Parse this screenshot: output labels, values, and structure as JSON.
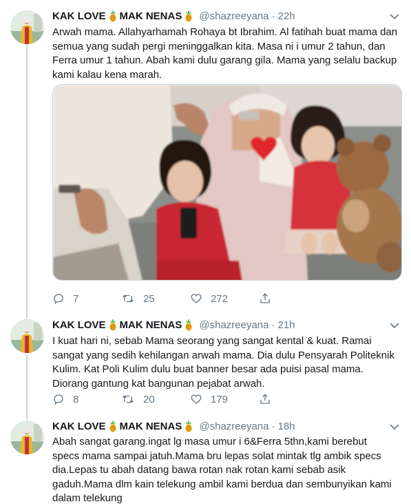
{
  "tweets": [
    {
      "display_name_1": "KAK LOVE",
      "display_name_2": "MAK NENAS",
      "handle": "@shazreeyana",
      "separator": "·",
      "time": "22h",
      "lines": [
        "Arwah mama. Allahyarhamah Rohaya bt Ibrahim. Al fatihah buat mama dan",
        "semua yang sudah pergi meninggalkan kita. Masa ni i umur 2 tahun, dan",
        "Ferra umur 1 tahun. Abah kami dulu garang gila. Mama yang selalu backup",
        "kami kalau kena marah."
      ],
      "replies": "7",
      "retweets": "25",
      "likes": "272"
    },
    {
      "display_name_1": "KAK LOVE",
      "display_name_2": "MAK NENAS",
      "handle": "@shazreeyana",
      "separator": "·",
      "time": "21h",
      "lines": [
        "I kuat hari ni, sebab Mama seorang yang sangat kental & kuat. Ramai",
        "sangat yang sedih kehilangan arwah mama. Dia dulu Pensyarah Politeknik",
        "Kulim. Kat Poli Kulim dulu buat banner besar ada puisi pasal mama.",
        "Diorang gantung kat bangunan pejabat arwah."
      ],
      "replies": "8",
      "retweets": "20",
      "likes": "179"
    },
    {
      "display_name_1": "KAK LOVE",
      "display_name_2": "MAK NENAS",
      "handle": "@shazreeyana",
      "separator": "·",
      "time": "18h",
      "lines": [
        "Abah sangat garang.ingat lg masa umur i 6&Ferra 5thn,kami berebut",
        "specs mama sampai jatuh.Mama bru lepas solat mintak tlg ambik specs",
        "dia.Lepas tu abah datang bawa rotan nak rotan kami sebab asik",
        "gaduh.Mama dlm kain telekung ambil kami berdua dan sembunyikan kami",
        "dalam telekung"
      ]
    }
  ],
  "icons": {
    "emoji": "pineapple-icon",
    "menu": "chevron-down-icon",
    "reply": "reply-icon",
    "retweet": "retweet-icon",
    "like": "heart-icon",
    "share": "share-icon"
  },
  "colors": {
    "text": "#14171a",
    "secondary": "#657786",
    "divider": "#e6ecf0",
    "thread_line": "#ccd6dd",
    "heart_sticker": "#e0272a"
  }
}
